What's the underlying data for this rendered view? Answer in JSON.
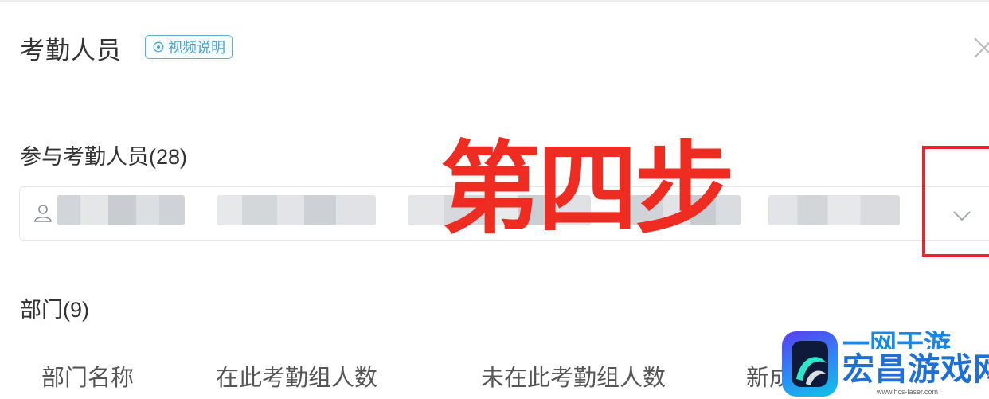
{
  "dialog": {
    "title": "考勤人员",
    "video_tag": "视频说明"
  },
  "participants": {
    "label": "参与考勤人员(28)"
  },
  "departments": {
    "label": "部门(9)",
    "columns": [
      "部门名称",
      "在此考勤组人数",
      "未在此考勤组人数",
      "新成"
    ]
  },
  "annotation": {
    "text": "第四步",
    "color": "#ee2c22"
  },
  "watermark": {
    "top_text": "一网干游",
    "name": "宏昌游戏网",
    "url": "www.hcs-laser.com"
  },
  "colors": {
    "accent": "#4aa7cf",
    "annotation_red": "#e8262b",
    "watermark_blue": "#1f6fd8"
  },
  "icons": {
    "video": "play-circle-icon",
    "close": "close-icon",
    "person": "user-icon",
    "dropdown": "chevron-down-icon"
  }
}
